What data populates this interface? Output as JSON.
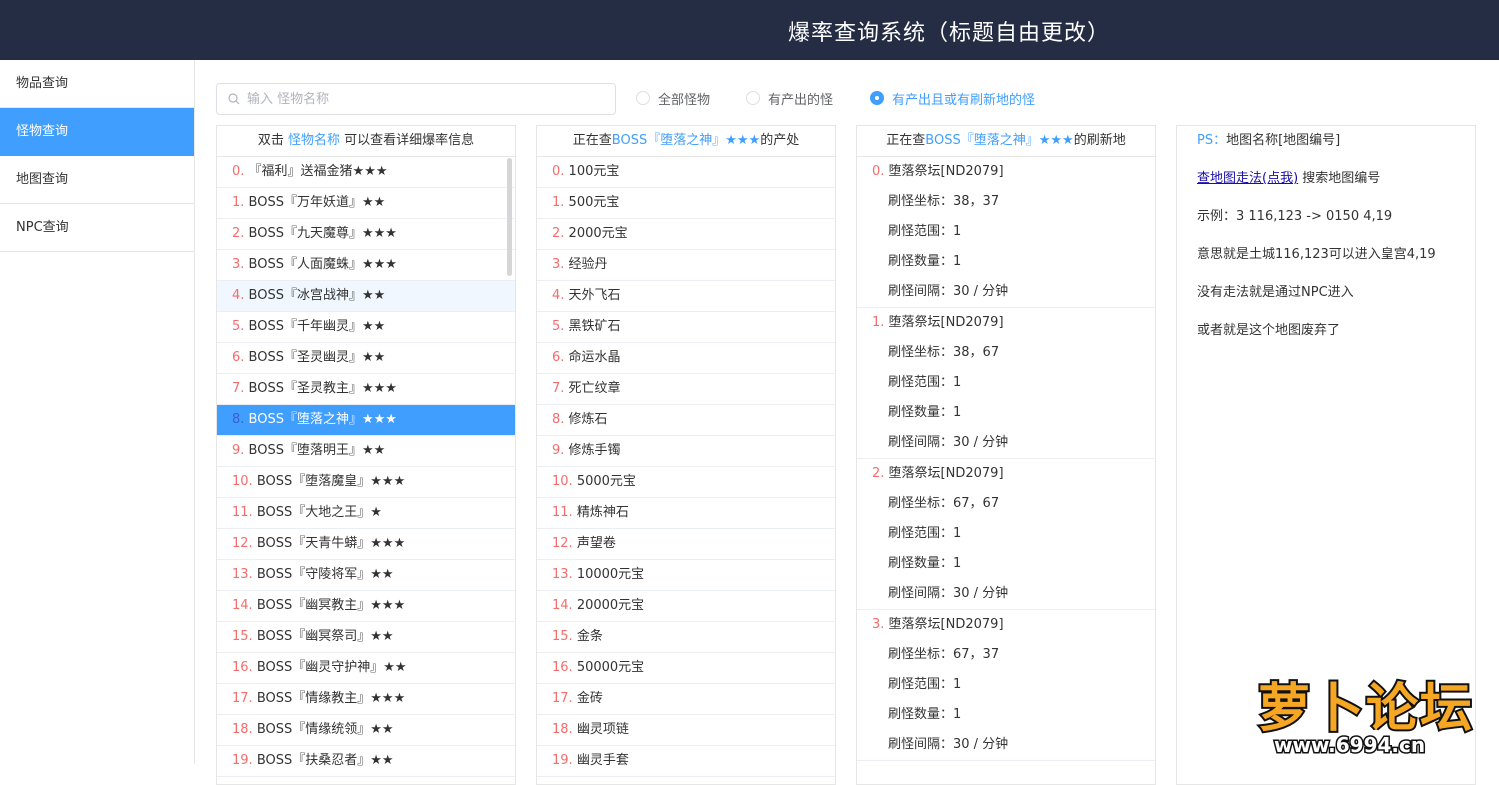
{
  "header": {
    "title": "爆率查询系统（标题自由更改）"
  },
  "sidebar": {
    "items": [
      {
        "label": "物品查询"
      },
      {
        "label": "怪物查询"
      },
      {
        "label": "地图查询"
      },
      {
        "label": "NPC查询"
      }
    ],
    "active_index": 1
  },
  "search": {
    "placeholder": "输入 怪物名称",
    "value": ""
  },
  "filters": {
    "options": [
      {
        "label": "全部怪物"
      },
      {
        "label": "有产出的怪"
      },
      {
        "label": "有产出且或有刷新地的怪"
      }
    ],
    "selected_index": 2
  },
  "monsters": {
    "header_pre": "双击 ",
    "header_link": "怪物名称",
    "header_post": " 可以查看详细爆率信息",
    "items": [
      {
        "idx": "0.",
        "name": "『福利』送福金猪★★★"
      },
      {
        "idx": "1.",
        "name": "BOSS『万年妖道』★★"
      },
      {
        "idx": "2.",
        "name": "BOSS『九天魔尊』★★★"
      },
      {
        "idx": "3.",
        "name": "BOSS『人面魔蛛』★★★"
      },
      {
        "idx": "4.",
        "name": "BOSS『冰宫战神』★★"
      },
      {
        "idx": "5.",
        "name": "BOSS『千年幽灵』★★"
      },
      {
        "idx": "6.",
        "name": "BOSS『圣灵幽灵』★★"
      },
      {
        "idx": "7.",
        "name": "BOSS『圣灵教主』★★★"
      },
      {
        "idx": "8.",
        "name": "BOSS『堕落之神』★★★"
      },
      {
        "idx": "9.",
        "name": "BOSS『堕落明王』★★"
      },
      {
        "idx": "10.",
        "name": "BOSS『堕落魔皇』★★★"
      },
      {
        "idx": "11.",
        "name": "BOSS『大地之王』★"
      },
      {
        "idx": "12.",
        "name": "BOSS『天青牛蟒』★★★"
      },
      {
        "idx": "13.",
        "name": "BOSS『守陵将军』★★"
      },
      {
        "idx": "14.",
        "name": "BOSS『幽冥教主』★★★"
      },
      {
        "idx": "15.",
        "name": "BOSS『幽冥祭司』★★"
      },
      {
        "idx": "16.",
        "name": "BOSS『幽灵守护神』★★"
      },
      {
        "idx": "17.",
        "name": "BOSS『情缘教主』★★★"
      },
      {
        "idx": "18.",
        "name": "BOSS『情缘统领』★★"
      },
      {
        "idx": "19.",
        "name": "BOSS『扶桑忍者』★★"
      }
    ],
    "hover_index": 4,
    "selected_index": 8
  },
  "drops": {
    "header_pre": "正在查",
    "header_name": "BOSS『堕落之神』★★★",
    "header_post": "的产处",
    "items": [
      {
        "idx": "0.",
        "name": "100元宝"
      },
      {
        "idx": "1.",
        "name": "500元宝"
      },
      {
        "idx": "2.",
        "name": "2000元宝"
      },
      {
        "idx": "3.",
        "name": "经验丹"
      },
      {
        "idx": "4.",
        "name": "天外飞石"
      },
      {
        "idx": "5.",
        "name": "黑铁矿石"
      },
      {
        "idx": "6.",
        "name": "命运水晶"
      },
      {
        "idx": "7.",
        "name": "死亡纹章"
      },
      {
        "idx": "8.",
        "name": "修炼石"
      },
      {
        "idx": "9.",
        "name": "修炼手镯"
      },
      {
        "idx": "10.",
        "name": "5000元宝"
      },
      {
        "idx": "11.",
        "name": "精炼神石"
      },
      {
        "idx": "12.",
        "name": "声望卷"
      },
      {
        "idx": "13.",
        "name": "10000元宝"
      },
      {
        "idx": "14.",
        "name": "20000元宝"
      },
      {
        "idx": "15.",
        "name": "金条"
      },
      {
        "idx": "16.",
        "name": "50000元宝"
      },
      {
        "idx": "17.",
        "name": "金砖"
      },
      {
        "idx": "18.",
        "name": "幽灵项链"
      },
      {
        "idx": "19.",
        "name": "幽灵手套"
      }
    ]
  },
  "spawns": {
    "header_pre": "正在查",
    "header_name": "BOSS『堕落之神』★★★",
    "header_post": "的刷新地",
    "groups": [
      {
        "idx": "0.",
        "map": "堕落祭坛[ND2079]",
        "coord": "刷怪坐标：38，37",
        "range": "刷怪范围：1",
        "count": "刷怪数量：1",
        "interval": "刷怪间隔：30 / 分钟"
      },
      {
        "idx": "1.",
        "map": "堕落祭坛[ND2079]",
        "coord": "刷怪坐标：38，67",
        "range": "刷怪范围：1",
        "count": "刷怪数量：1",
        "interval": "刷怪间隔：30 / 分钟"
      },
      {
        "idx": "2.",
        "map": "堕落祭坛[ND2079]",
        "coord": "刷怪坐标：67，67",
        "range": "刷怪范围：1",
        "count": "刷怪数量：1",
        "interval": "刷怪间隔：30 / 分钟"
      },
      {
        "idx": "3.",
        "map": "堕落祭坛[ND2079]",
        "coord": "刷怪坐标：67，37",
        "range": "刷怪范围：1",
        "count": "刷怪数量：1",
        "interval": "刷怪间隔：30 / 分钟"
      }
    ]
  },
  "info": {
    "ps_label": "PS：",
    "ps_text": "地图名称[地图编号]",
    "link_text": "查地图走法(点我)",
    "link_after": " 搜索地图编号",
    "example": "示例：3 116,123 -> 0150 4,19",
    "meaning": "意思就是土城116,123可以进入皇宫4,19",
    "no_route": "没有走法就是通过NPC进入",
    "abandoned": "或者就是这个地图废弃了"
  },
  "watermark": {
    "text": "萝卜论坛",
    "site": "www.6994.cn"
  },
  "colors": {
    "header_bg": "#252d45",
    "accent": "#409eff",
    "index": "#f56c6c"
  }
}
